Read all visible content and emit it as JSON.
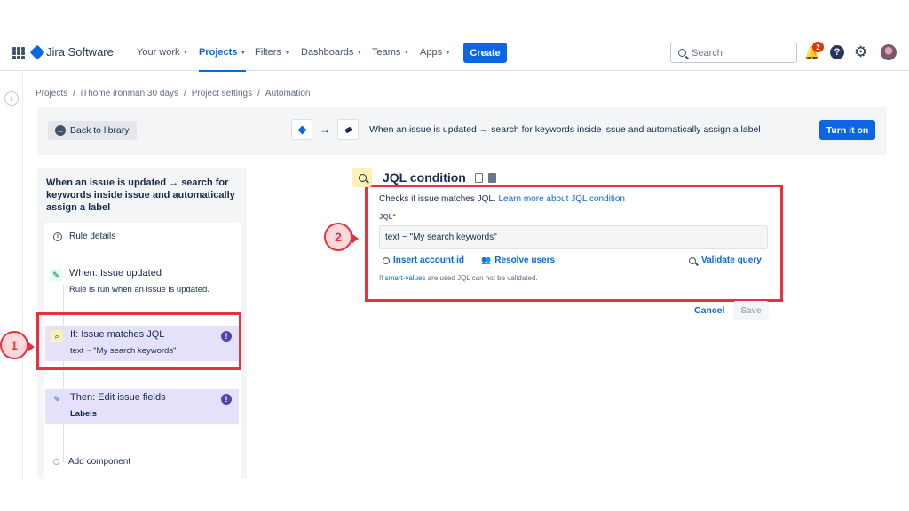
{
  "nav": {
    "brand": "Jira Software",
    "items": [
      {
        "label": "Your work"
      },
      {
        "label": "Projects"
      },
      {
        "label": "Filters"
      },
      {
        "label": "Dashboards"
      },
      {
        "label": "Teams"
      },
      {
        "label": "Apps"
      }
    ],
    "create_label": "Create",
    "search_placeholder": "Search",
    "notification_count": "2",
    "help_label": "?"
  },
  "breadcrumb": [
    "Projects",
    "iThome ironman 30 days",
    "Project settings",
    "Automation"
  ],
  "breadcrumb_sep": "/",
  "header": {
    "back_label": "Back to library",
    "rule_summary": "When an issue is updated → search for keywords inside issue and automatically assign a label",
    "turn_on_label": "Turn it on"
  },
  "left_panel": {
    "title": "When an issue is updated → search for keywords inside issue and automatically assign a label",
    "rule_details": "Rule details",
    "steps": [
      {
        "title": "When: Issue updated",
        "subtitle": "Rule is run when an issue is updated."
      },
      {
        "title": "If: Issue matches JQL",
        "subtitle": "text ~ \"My search keywords\""
      },
      {
        "title": "Then: Edit issue fields",
        "subtitle": "Labels"
      }
    ],
    "add_component": "Add component"
  },
  "annotations": [
    "1",
    "2"
  ],
  "jql": {
    "title": "JQL condition",
    "desc": "Checks if issue matches JQL.",
    "learn_more": "Learn more about JQL condition",
    "label": "JQL",
    "required_mark": "*",
    "value": "text ~ \"My search keywords\"",
    "insert_account": "Insert account id",
    "resolve_users": "Resolve users",
    "validate": "Validate query",
    "note_prefix": "If",
    "note_link": "smart-values",
    "note_suffix": "are used JQL can not be validated.",
    "cancel": "Cancel",
    "save": "Save"
  },
  "colors": {
    "accent": "#0c66e4",
    "annotation": "#e5323e",
    "warning": "#5243aa"
  }
}
